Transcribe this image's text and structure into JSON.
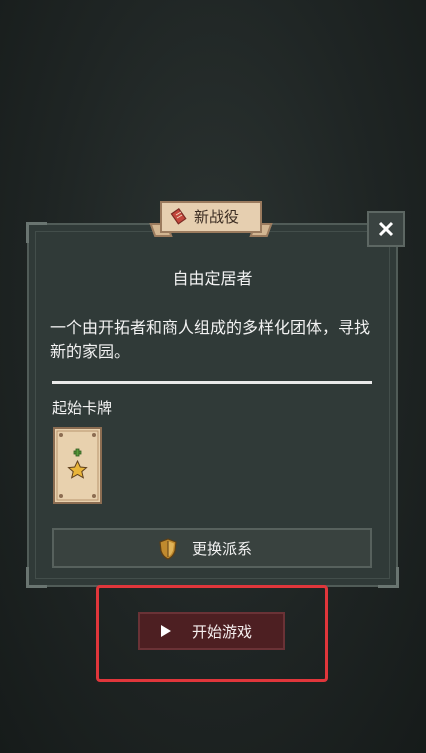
{
  "dialog": {
    "ribbon_label": "新战役",
    "title": "自由定居者",
    "description": "一个由开拓者和商人组成的多样化团体，寻找新的家园。",
    "section_label": "起始卡牌",
    "change_label": "更换派系"
  },
  "close": {
    "icon": "close-icon"
  },
  "start": {
    "label": "开始游戏",
    "icon": "play-icon"
  },
  "colors": {
    "background": "#1f2524",
    "panel": "#303a38",
    "card": "#e8d1ae",
    "start_button": "#4d1f22",
    "highlight": "#e0363b",
    "card_plus": "#5a9b3c",
    "card_star": "#e9b53a"
  }
}
